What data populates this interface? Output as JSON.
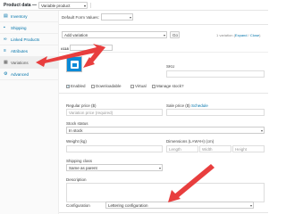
{
  "header": {
    "title": "Product data —",
    "product_type": "Variable product"
  },
  "sidebar": {
    "items": [
      {
        "label": "Inventory",
        "icon": "inventory-icon"
      },
      {
        "label": "Shipping",
        "icon": "truck-icon"
      },
      {
        "label": "Linked Products",
        "icon": "link-icon"
      },
      {
        "label": "Attributes",
        "icon": "list-icon"
      },
      {
        "label": "Variations",
        "icon": "grid-icon",
        "active": true
      },
      {
        "label": "Advanced",
        "icon": "gear-icon"
      }
    ]
  },
  "main": {
    "default_form_values_label": "Default Form Values:",
    "default_form_values_select": "",
    "add_variation_select": "Add variation",
    "go_button": "Go",
    "variations_count": "1 variation",
    "expand_label": "Expand",
    "close_label": "Close",
    "variation_number": "#118",
    "variation_select": "",
    "sku_label": "SKU",
    "sku_value": "",
    "checkboxes": [
      {
        "label": "Enabled",
        "checked": true
      },
      {
        "label": "Downloadable",
        "checked": false
      },
      {
        "label": "Virtual",
        "checked": false
      },
      {
        "label": "Manage stock?",
        "checked": false
      }
    ],
    "regular_price_label": "Regular price ($)",
    "regular_price_placeholder": "Variation price (required)",
    "sale_price_label": "Sale price ($)",
    "schedule_label": "Schedule",
    "stock_status_label": "Stock status",
    "stock_status_value": "In stock",
    "weight_label": "Weight (kg)",
    "dimensions_label": "Dimensions (L×W×H) (cm)",
    "length_placeholder": "Length",
    "width_placeholder": "Width",
    "height_placeholder": "Height",
    "shipping_class_label": "Shipping class",
    "shipping_class_value": "Same as parent",
    "description_label": "Description",
    "configuration_label": "Configuration",
    "configuration_value": "Lettering configuration"
  },
  "colors": {
    "link": "#0073aa",
    "arrow": "#e83e3e",
    "thumbnail": "#0a8ad7"
  }
}
